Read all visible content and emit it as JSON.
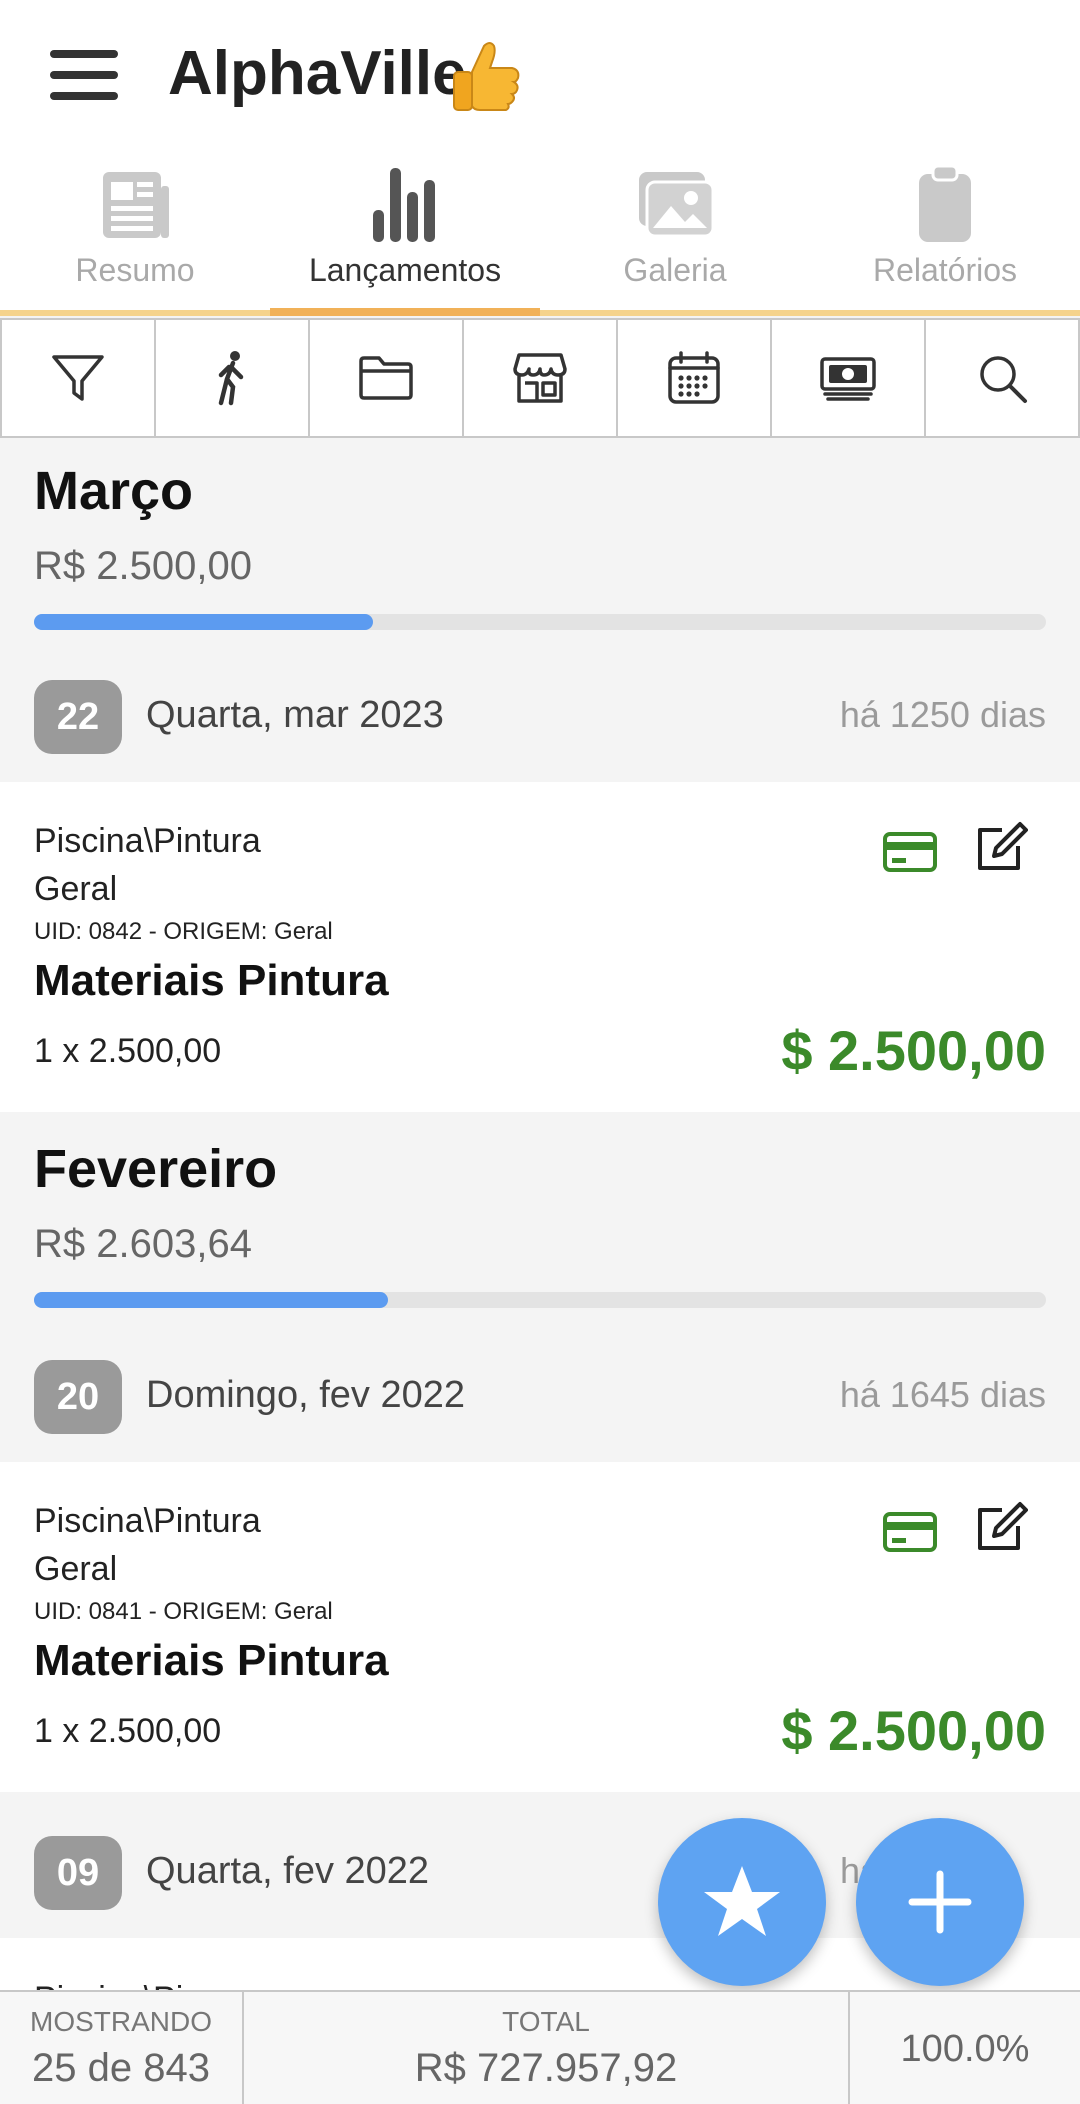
{
  "app": {
    "title": "AlphaVille"
  },
  "tabs": [
    {
      "label": "Resumo",
      "icon": "newspaper-icon",
      "active": false
    },
    {
      "label": "Lançamentos",
      "icon": "bar-chart-icon",
      "active": true
    },
    {
      "label": "Galeria",
      "icon": "gallery-icon",
      "active": false
    },
    {
      "label": "Relatórios",
      "icon": "clipboard-icon",
      "active": false
    }
  ],
  "toolbar": [
    "filter-icon",
    "walking-person-icon",
    "folder-icon",
    "store-icon",
    "calendar-icon",
    "money-icon",
    "search-icon"
  ],
  "months": [
    {
      "name": "Março",
      "total": "R$ 2.500,00",
      "progress": 0.335,
      "days": [
        {
          "day": "22",
          "label": "Quarta,  mar 2023",
          "ago": "há 1250 dias",
          "entry": {
            "path": "Piscina\\Pintura",
            "origin": "Geral",
            "uid": "UID: 0842 - ORIGEM: Geral",
            "description": "Materiais Pintura",
            "qty": "1 x 2.500,00",
            "amount": "$ 2.500,00"
          }
        }
      ]
    },
    {
      "name": "Fevereiro",
      "total": "R$ 2.603,64",
      "progress": 0.35,
      "days": [
        {
          "day": "20",
          "label": "Domingo,  fev 2022",
          "ago": "há 1645 dias",
          "entry": {
            "path": "Piscina\\Pintura",
            "origin": "Geral",
            "uid": "UID: 0841 - ORIGEM: Geral",
            "description": "Materiais Pintura",
            "qty": "1 x 2.500,00",
            "amount": "$ 2.500,00"
          }
        },
        {
          "day": "09",
          "label": "Quarta,  fev 2022",
          "ago": "há",
          "entry": {
            "path": "Piscina\\Pi"
          }
        }
      ]
    }
  ],
  "fabs": {
    "favorite": "star-icon",
    "add": "plus-icon"
  },
  "footer": {
    "showing_label": "MOSTRANDO",
    "showing_value": "25 de 843",
    "total_label": "TOTAL",
    "total_value": "R$ 727.957,92",
    "percent": "100.0%"
  },
  "colors": {
    "accent_blue": "#5c9bf0",
    "tab_underline": "#f1b158",
    "amount_green": "#3b8a2a"
  }
}
